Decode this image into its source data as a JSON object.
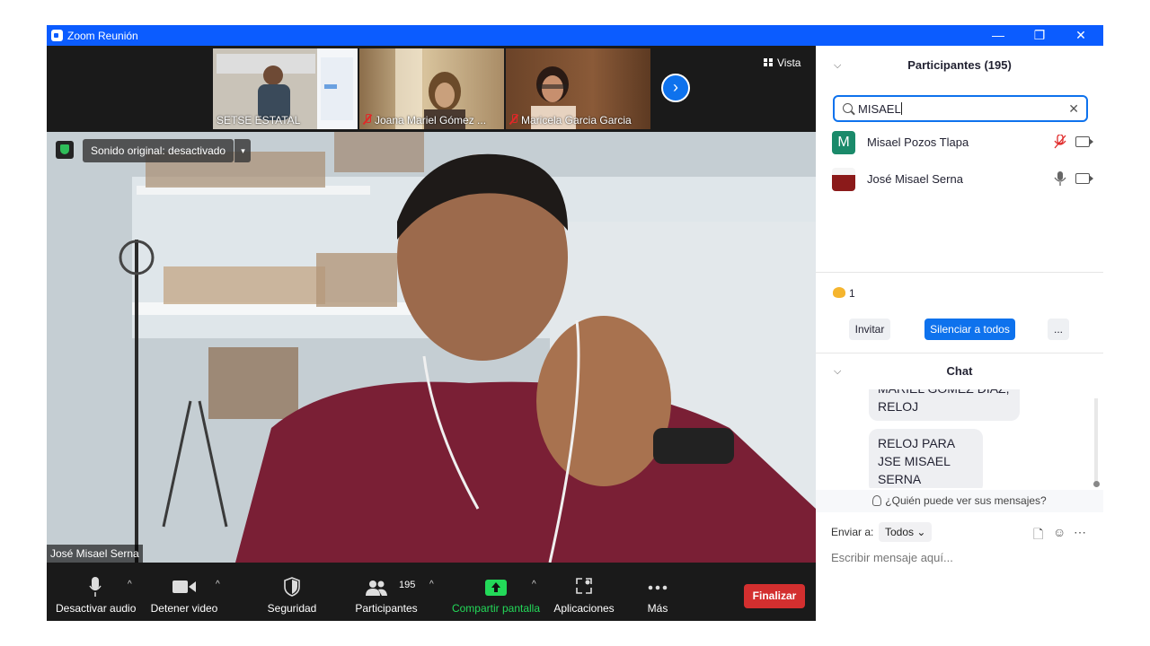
{
  "window": {
    "title": "Zoom Reunión",
    "controls": [
      "—",
      "❐",
      "✕"
    ]
  },
  "strip": {
    "tiles": [
      {
        "name": "SETSE ESTATAL",
        "muted": false
      },
      {
        "name": "Joana Mariel Gómez ...",
        "muted": true
      },
      {
        "name": "Maricela Garcia Garcia",
        "muted": true
      }
    ],
    "next_arrow": "›",
    "view_label": "Vista"
  },
  "main_video": {
    "original_sound": "Sonido original: desactivado",
    "dropdown_arrow": "▾",
    "speaker_name": "José Misael Serna"
  },
  "toolbar": {
    "audio": "Desactivar audio",
    "video": "Detener video",
    "security": "Seguridad",
    "participants": "Participantes",
    "participants_count": "195",
    "share": "Compartir pantalla",
    "apps": "Aplicaciones",
    "more": "Más",
    "end": "Finalizar",
    "caret": "^"
  },
  "panel": {
    "participants_title": "Participantes (195)",
    "search_value": "MISAEL",
    "participants": [
      {
        "initial": "M",
        "name": "Misael Pozos Tlapa",
        "avatar_color": "#1a8a6a",
        "mic_muted": true
      },
      {
        "initial": "",
        "name": "José Misael Serna",
        "avatar_color": "#8b1a1a",
        "mic_muted": false
      }
    ],
    "reaction_count": "1",
    "invite": "Invitar",
    "mute_all": "Silenciar a todos",
    "more": "...",
    "chat_title": "Chat",
    "messages": [
      {
        "lines": "MARIEL GOMEZ DÍAZ, RELOJ"
      },
      {
        "lines": "RELOJ PARA JSE MISAEL SERNA"
      }
    ],
    "who_can_see": "¿Quién puede ver sus mensajes?",
    "send_to_label": "Enviar a:",
    "send_to_value": "Todos",
    "compose_placeholder": "Escribir mensaje aquí..."
  },
  "colors": {
    "zoom_blue": "#0b5cff",
    "button_blue": "#0e72ed",
    "end_red": "#d32f2f",
    "share_green": "#23d959"
  }
}
